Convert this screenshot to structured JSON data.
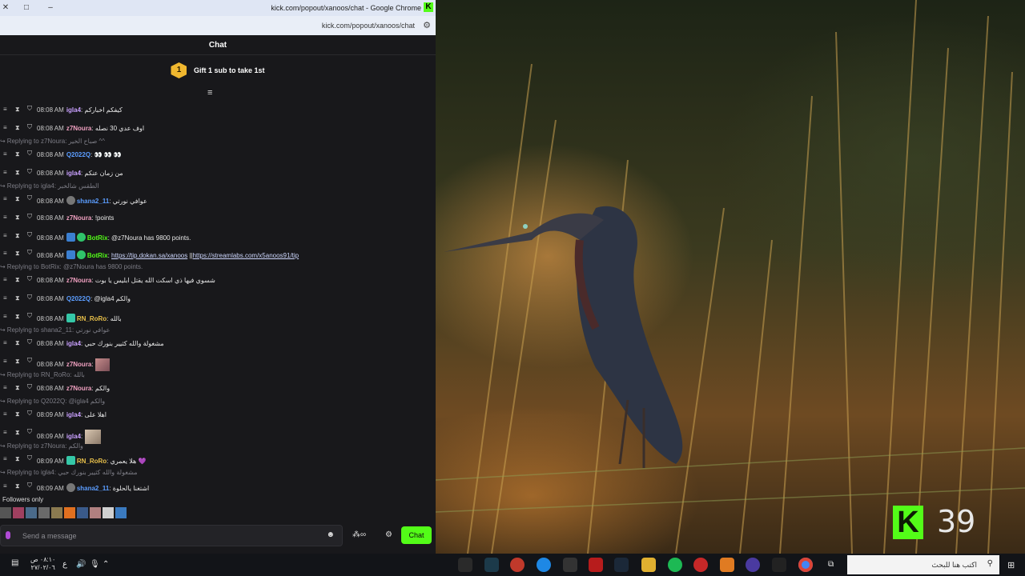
{
  "window": {
    "title": "kick.com/popout/xanoos/chat - Google Chrome",
    "url": "kick.com/popout/xanoos/chat"
  },
  "chat": {
    "header": "Chat",
    "gift_rank": "1",
    "gift_label": "Gift 1 sub to take 1st",
    "messages": [
      {
        "time": "08:08 AM",
        "user": "igla4",
        "text": "كيفكم اخباركم",
        "color": "#c9a0ff"
      },
      {
        "time": "08:08 AM",
        "user": "z7Noura",
        "text": "اوف عدي 30 نصله",
        "color": "#f0a0c0"
      },
      {
        "reply": "Replying to z7Noura: صباح الخير ^^"
      },
      {
        "time": "08:08 AM",
        "user": "Q2022Q",
        "text": "👀 👀 👀",
        "color": "#5b9dff"
      },
      {
        "time": "08:08 AM",
        "user": "igla4",
        "text": "من زمان عنكم",
        "color": "#c9a0ff"
      },
      {
        "reply": "Replying to igla4: الطقس شالخبر"
      },
      {
        "time": "08:08 AM",
        "user": "shana2_11",
        "text": "عوافي نورتي",
        "color": "#5b9dff",
        "pre_badge": "gray"
      },
      {
        "time": "08:08 AM",
        "user": "z7Noura",
        "text": "!points",
        "color": "#f0a0c0"
      },
      {
        "time": "08:08 AM",
        "user": "BotRix",
        "text": "@z7Noura has 9800 points.",
        "color": "#53fc18",
        "badges": [
          "blue",
          "green"
        ]
      },
      {
        "time": "08:08 AM",
        "user": "BotRix",
        "link1": "https://tip.dokan.sa/xanoos",
        "sep": " ||",
        "link2": "https://streamlabs.com/x5anoos91/tip",
        "color": "#53fc18",
        "badges": [
          "blue",
          "green"
        ]
      },
      {
        "reply": "Replying to BotRix: @z7Noura has 9800 points."
      },
      {
        "time": "08:08 AM",
        "user": "z7Noura",
        "text": "شسوي فيها ذي اسكت الله يقتل ابليس يا بوت",
        "color": "#f0a0c0"
      },
      {
        "time": "08:08 AM",
        "user": "Q2022Q",
        "text": "@igla4 والكم",
        "color": "#5b9dff"
      },
      {
        "time": "08:08 AM",
        "user": "RN_RoRo",
        "text": "بالله",
        "color": "#e8c04a",
        "badges": [
          "teal"
        ]
      },
      {
        "reply": "Replying to shana2_11: عوافي نورتي"
      },
      {
        "time": "08:08 AM",
        "user": "igla4",
        "text": "مشغولة والله كثيير بنورك حبي",
        "color": "#c9a0ff"
      },
      {
        "time": "08:08 AM",
        "user": "z7Noura",
        "emote": true,
        "color": "#f0a0c0"
      },
      {
        "reply": "Replying to RN_RoRo: بالله"
      },
      {
        "time": "08:08 AM",
        "user": "z7Noura",
        "text": "والكم",
        "color": "#f0a0c0"
      },
      {
        "reply": "Replying to Q2022Q: @igla4 والكم"
      },
      {
        "time": "08:09 AM",
        "user": "igla4",
        "text": "اهلا على",
        "color": "#c9a0ff"
      },
      {
        "time": "08:09 AM",
        "user": "igla4",
        "emote2": true,
        "color": "#c9a0ff"
      },
      {
        "reply": "Replying to z7Noura: والكم"
      },
      {
        "time": "08:09 AM",
        "user": "RN_RoRo",
        "text": "هلا يعمري 💜",
        "color": "#e8c04a",
        "badges": [
          "teal"
        ]
      },
      {
        "reply": "Replying to igla4: مشغولة والله كثيير بنورك حبي"
      },
      {
        "time": "08:09 AM",
        "user": "shana2_11",
        "text": "اشتغنا يالحلوة",
        "color": "#5b9dff",
        "pre_badge": "gray"
      }
    ],
    "followers_only": "Followers only",
    "input_placeholder": "Send a message",
    "send_label": "Chat"
  },
  "overlay": {
    "viewer_count": "39"
  },
  "taskbar": {
    "time": "٠٨:١٠ ص",
    "date": "٢٧/٠٢/٠٦",
    "lang": "ع",
    "search_placeholder": "اكتب هنا للبحث"
  },
  "colors": {
    "kick_green": "#53fc18",
    "chat_bg": "#18181b"
  }
}
